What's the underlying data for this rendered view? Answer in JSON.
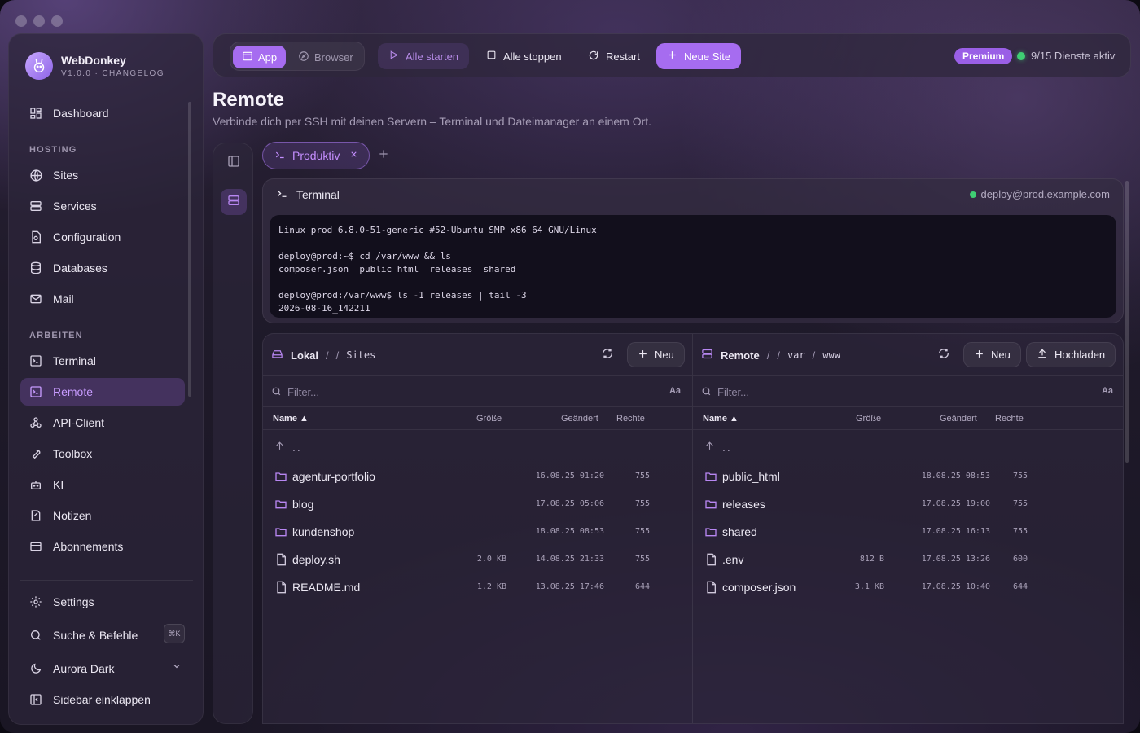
{
  "brand": {
    "name": "WebDonkey",
    "sub": "V1.0.0 · CHANGELOG"
  },
  "sidebar": {
    "top": [
      {
        "label": "Dashboard",
        "icon": "dashboard-icon"
      }
    ],
    "hosting_label": "HOSTING",
    "hosting": [
      {
        "label": "Sites",
        "icon": "globe-icon"
      },
      {
        "label": "Services",
        "icon": "server-icon"
      },
      {
        "label": "Configuration",
        "icon": "config-file-icon"
      },
      {
        "label": "Databases",
        "icon": "database-icon"
      },
      {
        "label": "Mail",
        "icon": "mail-icon"
      }
    ],
    "arbeiten_label": "ARBEITEN",
    "arbeiten": [
      {
        "label": "Terminal",
        "icon": "terminal-icon"
      },
      {
        "label": "Remote",
        "icon": "remote-terminal-icon",
        "active": true
      },
      {
        "label": "API-Client",
        "icon": "webhook-icon"
      },
      {
        "label": "Toolbox",
        "icon": "wrench-icon"
      },
      {
        "label": "KI",
        "icon": "bot-icon"
      },
      {
        "label": "Notizen",
        "icon": "notes-icon"
      },
      {
        "label": "Abonnements",
        "icon": "card-icon"
      }
    ],
    "bottom": {
      "settings": "Settings",
      "search": "Suche & Befehle",
      "search_kbd": "⌘K",
      "theme": "Aurora Dark",
      "collapse": "Sidebar einklappen"
    }
  },
  "topbar": {
    "app": "App",
    "browser": "Browser",
    "start_all": "Alle starten",
    "stop_all": "Alle stoppen",
    "restart": "Restart",
    "new_site": "Neue Site",
    "premium": "Premium",
    "status": "9/15 Dienste aktiv"
  },
  "page": {
    "title": "Remote",
    "subtitle": "Verbinde dich per SSH mit deinen Servern – Terminal und Dateimanager an einem Ort."
  },
  "tabs": [
    {
      "label": "Produktiv"
    }
  ],
  "terminal": {
    "title": "Terminal",
    "connection": "deploy@prod.example.com",
    "lines": [
      "Linux prod 6.8.0-51-generic #52-Ubuntu SMP x86_64 GNU/Linux",
      "",
      "deploy@prod:~$ cd /var/www && ls",
      "composer.json  public_html  releases  shared",
      "",
      "deploy@prod:/var/www$ ls -1 releases | tail -3",
      "2026-08-16_142211"
    ]
  },
  "local": {
    "root": "Lokal",
    "path": [
      "/",
      "Sites"
    ],
    "new_btn": "Neu",
    "filter_placeholder": "Filter...",
    "case_toggle": "Aa",
    "columns": {
      "name": "Name ▲",
      "size": "Größe",
      "modified": "Geändert",
      "perms": "Rechte"
    },
    "parent": "..",
    "rows": [
      {
        "name": "agentur-portfolio",
        "type": "folder",
        "size": "",
        "modified": "16.08.25 01:20",
        "perms": "755"
      },
      {
        "name": "blog",
        "type": "folder",
        "size": "",
        "modified": "17.08.25 05:06",
        "perms": "755"
      },
      {
        "name": "kundenshop",
        "type": "folder",
        "size": "",
        "modified": "18.08.25 08:53",
        "perms": "755"
      },
      {
        "name": "deploy.sh",
        "type": "file",
        "size": "2.0 KB",
        "modified": "14.08.25 21:33",
        "perms": "755"
      },
      {
        "name": "README.md",
        "type": "file",
        "size": "1.2 KB",
        "modified": "13.08.25 17:46",
        "perms": "644"
      }
    ]
  },
  "remote": {
    "root": "Remote",
    "path": [
      "/",
      "var",
      "/",
      "www"
    ],
    "new_btn": "Neu",
    "upload_btn": "Hochladen",
    "filter_placeholder": "Filter...",
    "case_toggle": "Aa",
    "columns": {
      "name": "Name ▲",
      "size": "Größe",
      "modified": "Geändert",
      "perms": "Rechte"
    },
    "parent": "..",
    "rows": [
      {
        "name": "public_html",
        "type": "folder",
        "size": "",
        "modified": "18.08.25 08:53",
        "perms": "755"
      },
      {
        "name": "releases",
        "type": "folder",
        "size": "",
        "modified": "17.08.25 19:00",
        "perms": "755"
      },
      {
        "name": "shared",
        "type": "folder",
        "size": "",
        "modified": "17.08.25 16:13",
        "perms": "755"
      },
      {
        "name": ".env",
        "type": "file",
        "size": "812 B",
        "modified": "17.08.25 13:26",
        "perms": "600"
      },
      {
        "name": "composer.json",
        "type": "file",
        "size": "3.1 KB",
        "modified": "17.08.25 10:40",
        "perms": "644"
      }
    ]
  },
  "colors": {
    "accent": "#a66cf0",
    "status_ok": "#3fce73"
  }
}
